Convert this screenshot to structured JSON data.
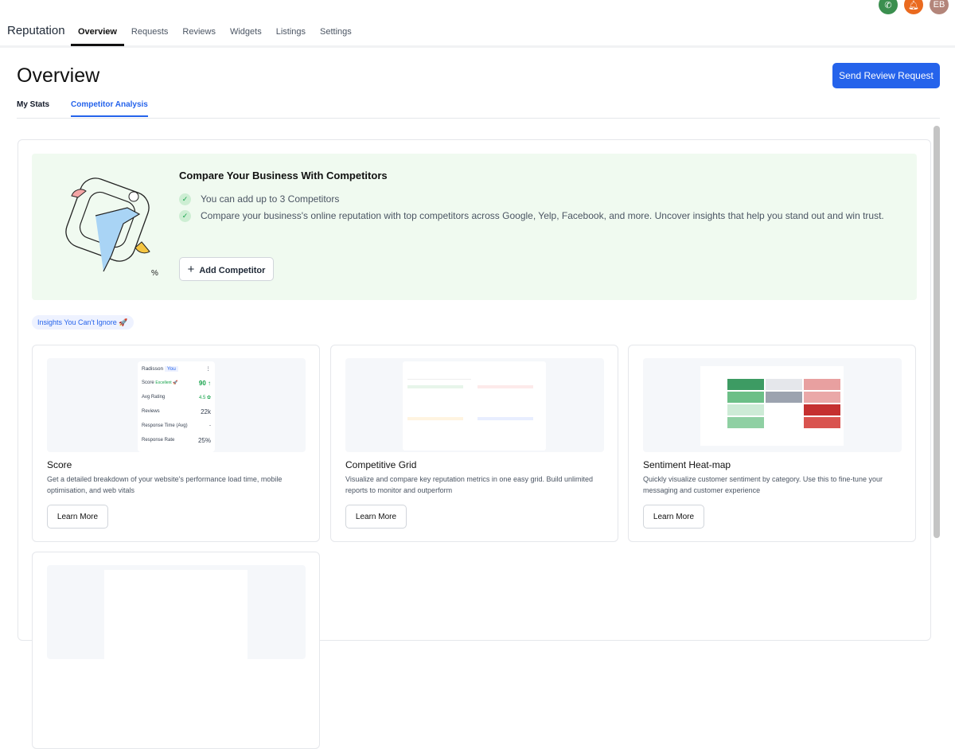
{
  "header": {
    "brand": "Reputation",
    "nav": [
      "Overview",
      "Requests",
      "Reviews",
      "Widgets",
      "Listings",
      "Settings"
    ],
    "avatar_initials": "EB"
  },
  "page": {
    "title": "Overview",
    "send_button": "Send Review Request",
    "tabs": [
      "My Stats",
      "Competitor Analysis"
    ]
  },
  "banner": {
    "title": "Compare Your Business With Competitors",
    "points": [
      "You can add up to 3 Competitors",
      "Compare your business's online reputation with top competitors across Google, Yelp, Facebook, and more. Uncover insights that help you stand out and win trust."
    ],
    "add_button": "Add Competitor"
  },
  "insights_pill": "Insights You Can't Ignore 🚀",
  "score_preview": {
    "name": "Radisson",
    "you": "You",
    "rows": [
      {
        "label": "Score",
        "badge": "Excellent 🚀",
        "value": "90 ↑"
      },
      {
        "label": "Avg Rating",
        "value": "4.5 ✿"
      },
      {
        "label": "Reviews",
        "value": "22k"
      },
      {
        "label": "Response Time (Avg)",
        "value": "-"
      },
      {
        "label": "Response Rate",
        "value": "25%"
      }
    ]
  },
  "cards": [
    {
      "title": "Score",
      "desc": "Get a detailed breakdown of your website's performance load time, mobile optimisation, and web vitals",
      "button": "Learn More"
    },
    {
      "title": "Competitive Grid",
      "desc": "Visualize and compare key reputation metrics in one easy grid. Build unlimited reports to monitor and outperform",
      "button": "Learn More"
    },
    {
      "title": "Sentiment Heat-map",
      "desc": "Quickly visualize customer sentiment by category. Use this to fine-tune your messaging and customer experience",
      "button": "Learn More"
    }
  ],
  "colors": {
    "accent": "#2563eb",
    "banner": "#f0faf0"
  }
}
